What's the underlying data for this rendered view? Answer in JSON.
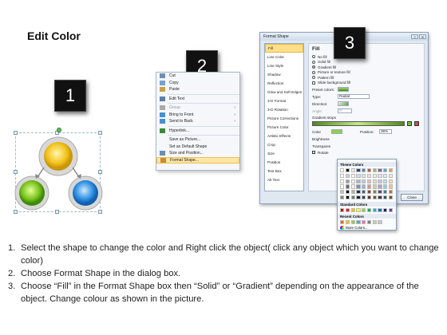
{
  "title": "Edit Color",
  "badges": [
    "1",
    "2",
    "3"
  ],
  "context_menu": {
    "items": [
      {
        "label": "Cut",
        "icon": "scissors-icon",
        "disabled": false
      },
      {
        "label": "Copy",
        "icon": "copy-icon",
        "disabled": false
      },
      {
        "label": "Paste",
        "icon": "paste-icon",
        "disabled": false
      },
      {
        "label": "Edit Text",
        "icon": "edit-text-icon",
        "disabled": false
      },
      {
        "label": "Group",
        "icon": "group-icon",
        "disabled": true,
        "submenu": true
      },
      {
        "label": "Bring to Front",
        "icon": "bring-front-icon",
        "disabled": false,
        "submenu": true
      },
      {
        "label": "Send to Back",
        "icon": "send-back-icon",
        "disabled": false,
        "submenu": true
      },
      {
        "label": "Hyperlink...",
        "icon": "hyperlink-icon",
        "disabled": false
      },
      {
        "label": "Save as Picture...",
        "icon": "none",
        "disabled": false
      },
      {
        "label": "Set as Default Shape",
        "icon": "none",
        "disabled": false
      },
      {
        "label": "Size and Position...",
        "icon": "size-icon",
        "disabled": false
      },
      {
        "label": "Format Shape...",
        "icon": "format-shape-icon",
        "disabled": false,
        "highlighted": true
      }
    ]
  },
  "dialog": {
    "title": "Format Shape",
    "nav": [
      "Fill",
      "Line Color",
      "Line Style",
      "Shadow",
      "Reflection",
      "Glow and Soft Edges",
      "3-D Format",
      "3-D Rotation",
      "Picture Corrections",
      "Picture Color",
      "Artistic Effects",
      "Crop",
      "Size",
      "Position",
      "Text Box",
      "Alt Text"
    ],
    "heading": "Fill",
    "fill_options": [
      {
        "label": "No fill",
        "selected": false
      },
      {
        "label": "Solid fill",
        "selected": false
      },
      {
        "label": "Gradient fill",
        "selected": true
      },
      {
        "label": "Picture or texture fill",
        "selected": false
      },
      {
        "label": "Pattern fill",
        "selected": false
      }
    ],
    "slide_background_fill": "Slide background fill",
    "preset_colors": "Preset colors:",
    "type": "Type:",
    "type_value": "Radial",
    "direction": "Direction:",
    "angle": "Angle:",
    "angle_value": "0°",
    "gradient_stops": "Gradient stops",
    "color": "Color",
    "position": "Position:",
    "position_value": "36%",
    "brightness": "Brightness",
    "transparency": "Transparen",
    "rotate": "Rotate",
    "close_button": "Close"
  },
  "color_popup": {
    "theme_colors": "Theme Colors",
    "standard_colors": "Standard Colors",
    "recent_colors": "Recent Colors",
    "more_colors": "More Colors...",
    "theme_row": [
      "#ffffff",
      "#000000",
      "#eeece1",
      "#1f497d",
      "#4f81bd",
      "#c0504d",
      "#9bbb59",
      "#8064a2",
      "#4bacc6",
      "#f79646"
    ],
    "standard_row": [
      "#c00000",
      "#ff0000",
      "#ffc000",
      "#ffff00",
      "#92d050",
      "#00b050",
      "#00b0f0",
      "#0070c0",
      "#002060",
      "#7030a0"
    ],
    "recent_row": [
      "#e46c0a",
      "#ffc000",
      "#92d050",
      "#4bacc6",
      "#ff66cc",
      "#7f7f7f",
      "#c3d69b",
      "#ccc1da"
    ]
  },
  "steps": [
    {
      "num": "1.",
      "text": "Select the shape to change the color and Right click the object( click any object which you want to change color)"
    },
    {
      "num": "2.",
      "text": "Choose Format Shape in the dialog box."
    },
    {
      "num": "3.",
      "text": "Choose “Fill” in the Format Shape box then “Solid” or “Gradient” depending on the appearance of the object. Change colour as shown in the picture."
    }
  ]
}
